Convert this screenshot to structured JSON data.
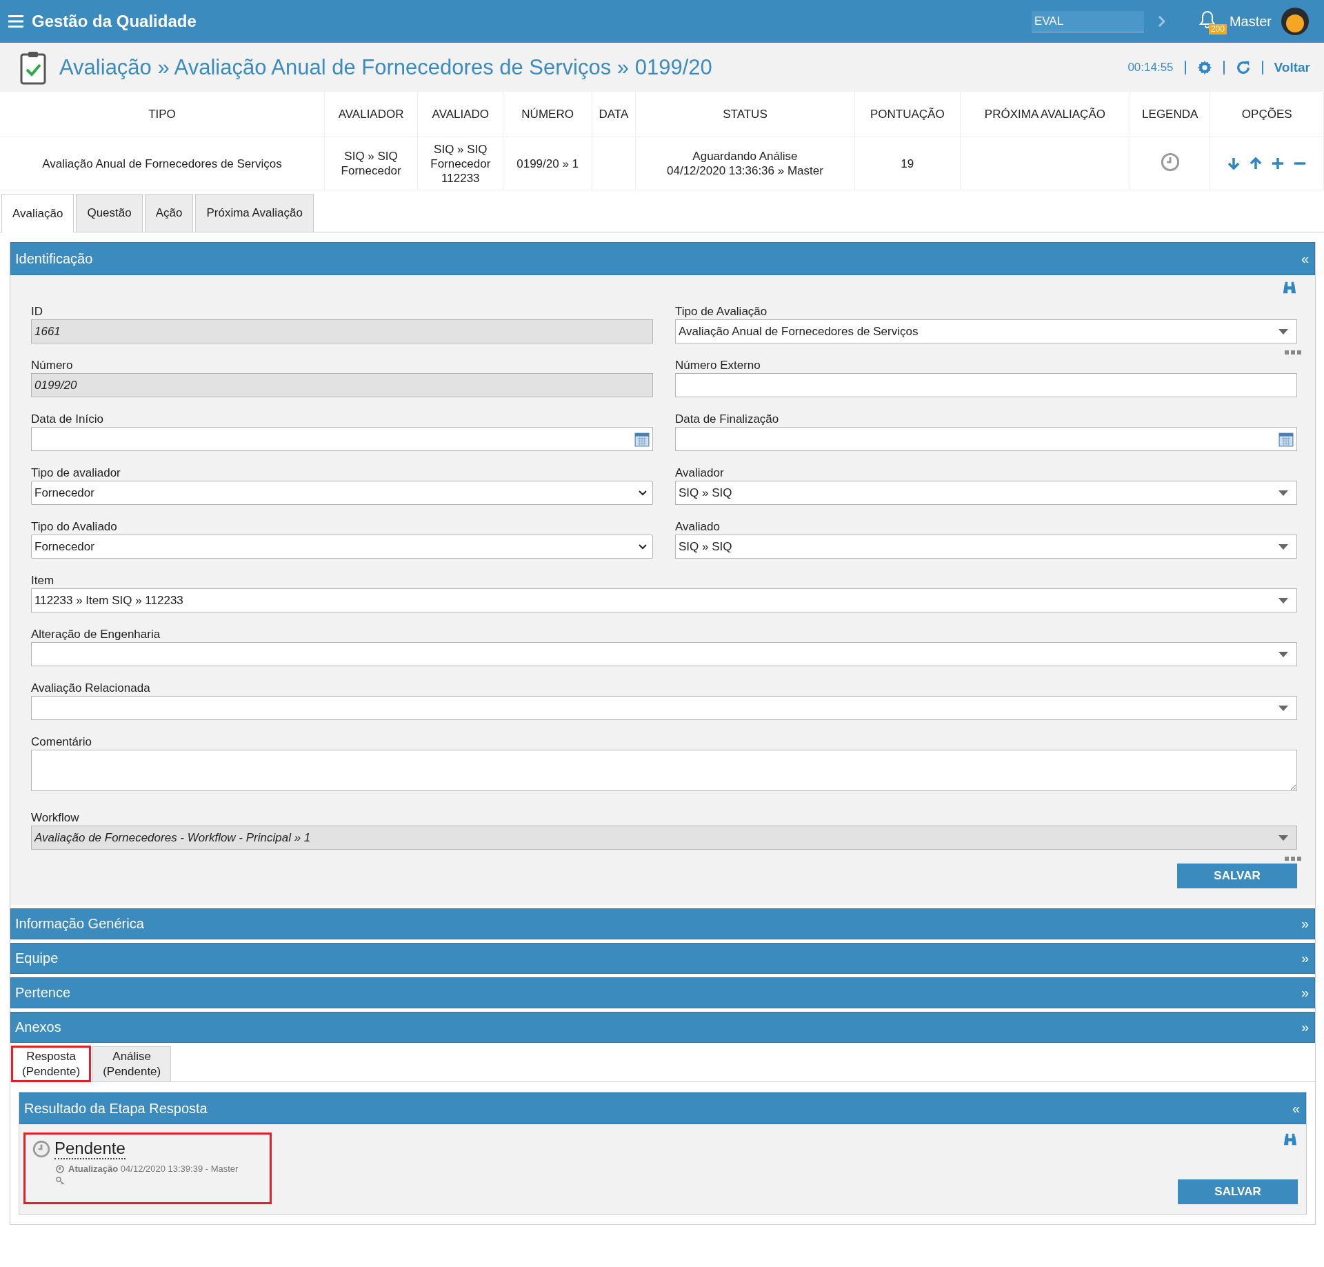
{
  "app_bar": {
    "title": "Gestão da Qualidade",
    "search_value": "EVAL",
    "notification_count": "200",
    "user": "Master"
  },
  "page_header": {
    "breadcrumb": "Avaliação » Avaliação Anual de Fornecedores de Serviços » 0199/20",
    "timer": "00:14:55",
    "back_link": "Voltar"
  },
  "summary_table": {
    "columns": [
      "TIPO",
      "AVALIADOR",
      "AVALIADO",
      "NÚMERO",
      "DATA",
      "STATUS",
      "PONTUAÇÃO",
      "PRÓXIMA AVALIAÇÃO",
      "LEGENDA",
      "OPÇÕES"
    ],
    "row": {
      "tipo": "Avaliação Anual de Fornecedores de Serviços",
      "avaliador": "SIQ » SIQ\nFornecedor",
      "avaliado": "SIQ » SIQ\nFornecedor\n112233",
      "numero": "0199/20 » 1",
      "status": "Aguardando Análise\n04/12/2020 13:36:36 » Master",
      "pontuacao": "19"
    }
  },
  "tabs": [
    {
      "label": "Avaliação",
      "selected": true
    },
    {
      "label": "Questão",
      "selected": false
    },
    {
      "label": "Ação",
      "selected": false
    },
    {
      "label": "Próxima Avaliação",
      "selected": false
    }
  ],
  "identification": {
    "title": "Identificação",
    "toggle": "«",
    "save": "SALVAR",
    "rows": [
      [
        {
          "kind": "text",
          "label": "ID",
          "value": "1661",
          "readonly": true
        },
        {
          "kind": "combo",
          "label": "Tipo de Avaliação",
          "value": "Avaliação Anual de Fornecedores de Serviços",
          "more": true
        }
      ],
      [
        {
          "kind": "text",
          "label": "Número",
          "value": "0199/20",
          "readonly": true
        },
        {
          "kind": "text",
          "label": "Número Externo"
        }
      ],
      [
        {
          "kind": "date",
          "label": "Data de Início"
        },
        {
          "kind": "date",
          "label": "Data de Finalização"
        }
      ],
      [
        {
          "kind": "select",
          "label": "Tipo de avaliador",
          "value": "Fornecedor"
        },
        {
          "kind": "combo",
          "label": "Avaliador",
          "value": "SIQ  »  SIQ"
        }
      ],
      [
        {
          "kind": "select",
          "label": "Tipo do Avaliado",
          "value": "Fornecedor"
        },
        {
          "kind": "combo",
          "label": "Avaliado",
          "value": "SIQ  »  SIQ"
        }
      ],
      [
        {
          "kind": "combo",
          "label": "Item",
          "value": "112233 » Item SIQ » 112233"
        }
      ],
      [
        {
          "kind": "combo",
          "label": "Alteração de Engenharia"
        }
      ],
      [
        {
          "kind": "combo",
          "label": "Avaliação Relacionada"
        }
      ],
      [
        {
          "kind": "textarea",
          "label": "Comentário"
        }
      ],
      [
        {
          "kind": "combo",
          "label": "Workflow",
          "value": "Avaliação de Fornecedores - Workflow - Principal » 1",
          "readonly": true,
          "more": true
        }
      ]
    ]
  },
  "sections": [
    {
      "title": "Informação Genérica",
      "toggle": "»"
    },
    {
      "title": "Equipe",
      "toggle": "»"
    },
    {
      "title": "Pertence",
      "toggle": "»"
    },
    {
      "title": "Anexos",
      "toggle": "»"
    }
  ],
  "step_tabs": [
    {
      "label": "Resposta\n(Pendente)",
      "selected": true,
      "highlighted": true
    },
    {
      "label": "Análise\n(Pendente)",
      "selected": false,
      "highlighted": false
    }
  ],
  "result": {
    "title": "Resultado da Etapa Resposta",
    "toggle": "«",
    "status": "Pendente",
    "update_label": "Atualização",
    "update_text": "04/12/2020 13:39:39 - Master",
    "highlighted": true,
    "save": "SALVAR"
  }
}
